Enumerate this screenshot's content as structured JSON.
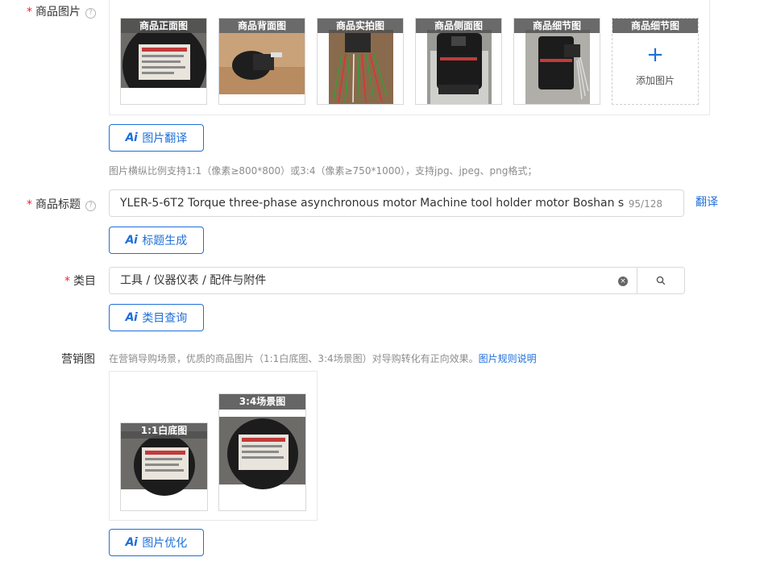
{
  "product_images": {
    "label": "商品图片",
    "required_mark": "*",
    "help_glyph": "?",
    "tiles": [
      {
        "caption": "商品正面图",
        "kind": "nameplate"
      },
      {
        "caption": "商品背面图",
        "kind": "back"
      },
      {
        "caption": "商品实拍图",
        "kind": "wires"
      },
      {
        "caption": "商品侧面图",
        "kind": "side"
      },
      {
        "caption": "商品细节图",
        "kind": "detail"
      }
    ],
    "add_tile": {
      "caption": "商品细节图",
      "plus": "+",
      "label": "添加图片"
    },
    "ai_button": "图片翻译",
    "hint": "图片横纵比例支持1:1（像素≥800*800）或3:4（像素≥750*1000），支持jpg、jpeg、png格式；"
  },
  "title_field": {
    "label": "商品标题",
    "required_mark": "*",
    "help_glyph": "?",
    "value": "YLER-5-6T2 Torque three-phase asynchronous motor Machine tool holder motor Boshan sp",
    "counter": "95/128",
    "translate_link": "翻译",
    "ai_button": "标题生成"
  },
  "category_field": {
    "label": "类目",
    "required_mark": "*",
    "value": "工具 / 仪器仪表 / 配件与附件",
    "clear_glyph": "×",
    "ai_button": "类目查询"
  },
  "marketing": {
    "label": "营销图",
    "description": "在营销导购场景，优质的商品图片（1:1白底图、3:4场景图）对导购转化有正向效果。",
    "rules_link": "图片规则说明",
    "tiles": [
      {
        "caption": "1:1白底图",
        "ratio": "1:1"
      },
      {
        "caption": "3:4场景图",
        "ratio": "3:4"
      }
    ],
    "ai_button": "图片优化"
  },
  "ai_glyph": "Ai",
  "colors": {
    "primary": "#1f6fd8",
    "required": "#f5222d",
    "border": "#d9d9d9",
    "hint": "#8c8c8c"
  }
}
